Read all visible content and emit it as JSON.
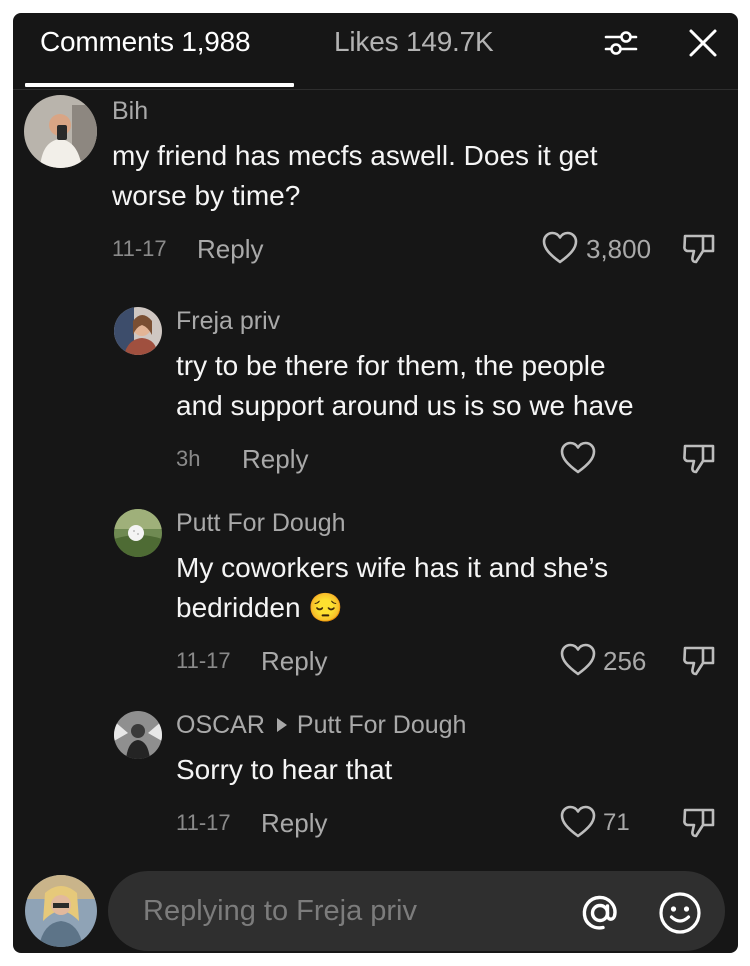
{
  "header": {
    "tab_comments": "Comments 1,988",
    "tab_likes": "Likes 149.7K",
    "filter_icon": "filter-sliders-icon",
    "close_icon": "close-icon"
  },
  "comments": [
    {
      "username": "Bih",
      "text_lines": [
        "my friend has mecfs aswell. Does it get",
        "worse by time?"
      ],
      "date": "11-17",
      "reply_label": "Reply",
      "likes": "3,800"
    },
    {
      "username": "Freja priv",
      "text_lines": [
        "try to be there for them, the people",
        "and support around us is so we have"
      ],
      "date": "3h",
      "reply_label": "Reply",
      "likes": ""
    },
    {
      "username": "Putt For Dough",
      "text_lines": [
        "My coworkers wife has it and she’s",
        "bedridden 😔"
      ],
      "date": "11-17",
      "reply_label": "Reply",
      "likes": "256"
    },
    {
      "username": "OSCAR",
      "reply_to": "Putt For Dough",
      "text_lines": [
        "Sorry to hear that"
      ],
      "date": "11-17",
      "reply_label": "Reply",
      "likes": "71"
    }
  ],
  "composer": {
    "placeholder": "Replying to Freja priv",
    "at_icon": "at-mention-icon",
    "emoji_icon": "emoji-icon"
  },
  "colors": {
    "background": "#161616",
    "text": "#f5f5f5",
    "muted": "#a9a9a9",
    "input_bg": "#2f2f2f"
  }
}
